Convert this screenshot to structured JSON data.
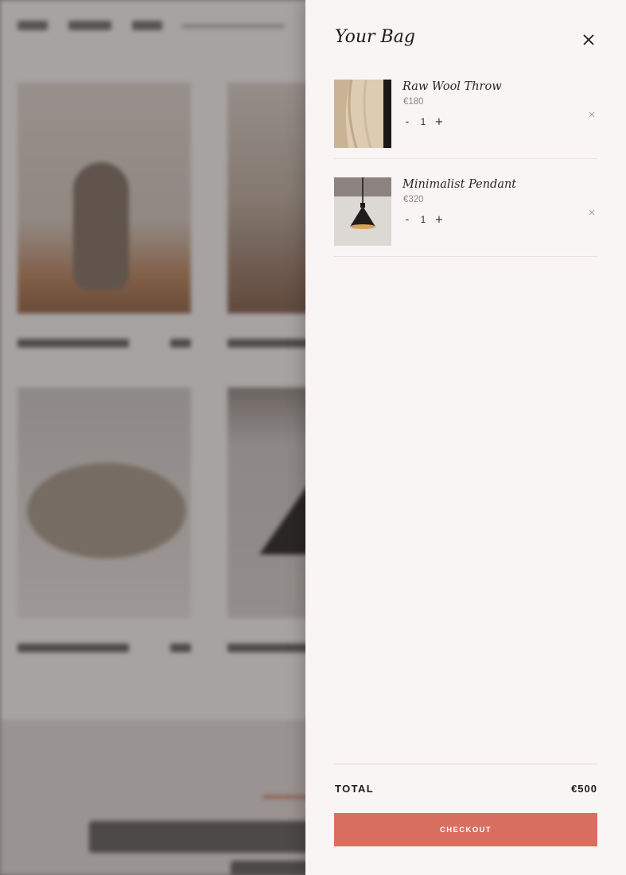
{
  "cart": {
    "title": "Your Bag",
    "items": [
      {
        "name": "Raw Wool Throw",
        "price": "€180",
        "quantity": "1",
        "decrease": "-",
        "increase": "+"
      },
      {
        "name": "Minimalist Pendant",
        "price": "€320",
        "quantity": "1",
        "decrease": "-",
        "increase": "+"
      }
    ],
    "total_label": "TOTAL",
    "total_value": "€500",
    "checkout_label": "CHECKOUT"
  },
  "colors": {
    "accent": "#d96f60",
    "drawer_background": "#faf5f5",
    "text_primary": "#1e1a1a",
    "text_muted": "#8f8887"
  },
  "icons": {
    "close": "close-icon",
    "remove": "remove-item-icon"
  }
}
